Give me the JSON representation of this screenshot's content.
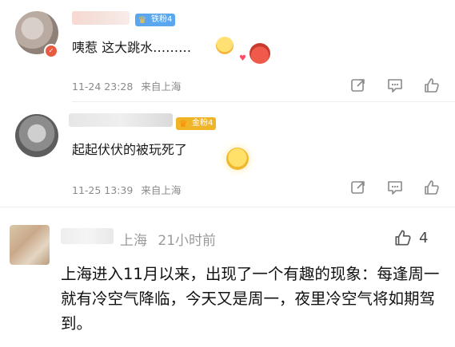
{
  "comments": [
    {
      "fan_badge": "铁粉4",
      "text": "咦惹  这大跳水………",
      "time": "11-24 23:28",
      "location": "来自上海"
    },
    {
      "fan_badge": "金粉4",
      "text": "起起伏伏的被玩死了",
      "time": "11-25 13:39",
      "location": "来自上海"
    }
  ],
  "post": {
    "location": "上海",
    "time_ago": "21小时前",
    "likes": "4",
    "text": "上海进入11月以来，出现了一个有趣的现象：每逢周一就有冷空气降临，今天又是周一，夜里冷空气将如期驾到。"
  },
  "icons": {
    "share": "share-icon",
    "comment": "comment-icon",
    "like": "thumbs-up-icon"
  },
  "colors": {
    "iron_fan_badge": "#5aa7f0",
    "gold_fan_badge": "#f0b429",
    "meta_text": "#8a8a8a"
  }
}
